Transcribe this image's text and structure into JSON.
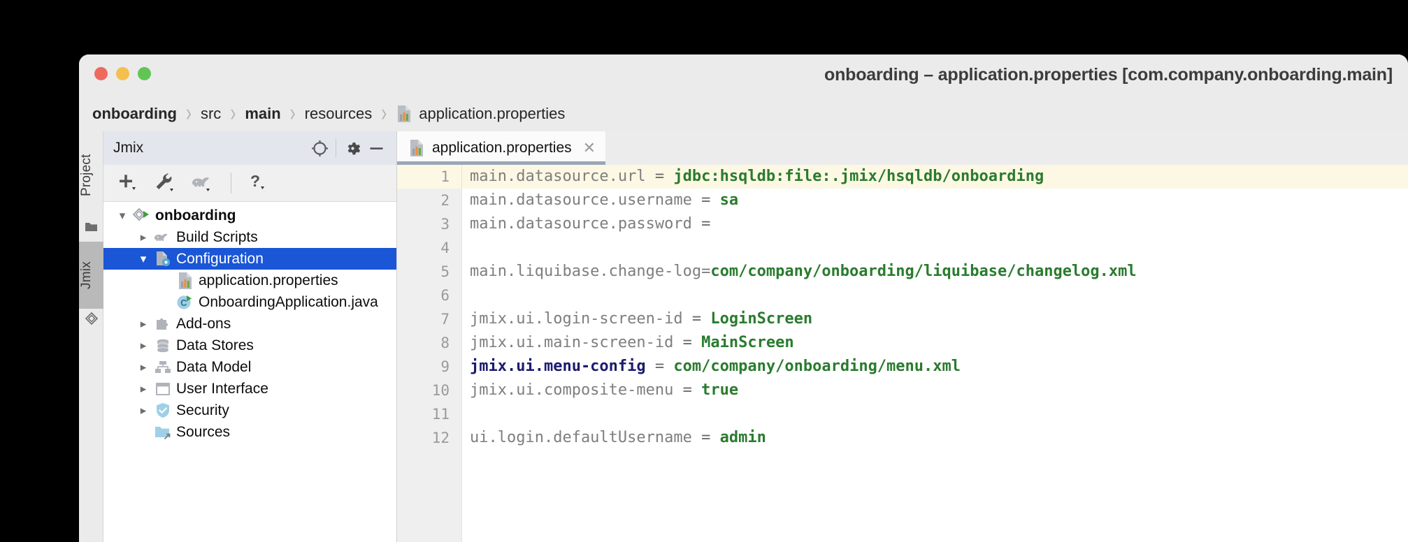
{
  "window": {
    "title": "onboarding – application.properties [com.company.onboarding.main]",
    "traffic_colors": {
      "close": "#ed6a5e",
      "minimize": "#f5bf4f",
      "zoom": "#61c554"
    }
  },
  "breadcrumb": {
    "items": [
      {
        "label": "onboarding",
        "bold": true,
        "icon": ""
      },
      {
        "label": "src",
        "bold": false,
        "icon": ""
      },
      {
        "label": "main",
        "bold": true,
        "icon": ""
      },
      {
        "label": "resources",
        "bold": false,
        "icon": ""
      },
      {
        "label": "application.properties",
        "bold": false,
        "icon": "properties-file-icon"
      }
    ],
    "separator": "›"
  },
  "stripe": {
    "labels": [
      {
        "text": "Project",
        "active": false,
        "icon": "folder-icon"
      },
      {
        "text": "Jmix",
        "active": true,
        "icon": "jmix-logo-icon"
      }
    ]
  },
  "toolwindow": {
    "title": "Jmix",
    "header_buttons": [
      {
        "name": "locate-target-icon",
        "glyph": "⌖"
      },
      {
        "name": "gear-icon",
        "glyph": "⚙"
      },
      {
        "name": "minimize-icon",
        "glyph": "—"
      }
    ],
    "toolbar_buttons": [
      {
        "name": "add-button",
        "icon": "plus-icon"
      },
      {
        "name": "settings-button",
        "icon": "wrench-icon"
      },
      {
        "name": "gradle-button",
        "icon": "elephant-icon"
      },
      {
        "name": "help-button",
        "icon": "question-mark-icon"
      }
    ],
    "tree": [
      {
        "label": "onboarding",
        "indent": 0,
        "arrow": "down",
        "icon": "jmix-project-icon",
        "bold": true,
        "selected": false
      },
      {
        "label": "Build Scripts",
        "indent": 1,
        "arrow": "right",
        "icon": "elephant-icon",
        "bold": false,
        "selected": false
      },
      {
        "label": "Configuration",
        "indent": 1,
        "arrow": "down",
        "icon": "configuration-icon",
        "bold": false,
        "selected": true
      },
      {
        "label": "application.properties",
        "indent": 2,
        "arrow": "none",
        "icon": "properties-file-icon",
        "bold": false,
        "selected": false
      },
      {
        "label": "OnboardingApplication.java",
        "indent": 2,
        "arrow": "none",
        "icon": "java-class-run-icon",
        "bold": false,
        "selected": false
      },
      {
        "label": "Add-ons",
        "indent": 1,
        "arrow": "right",
        "icon": "puzzle-icon",
        "bold": false,
        "selected": false
      },
      {
        "label": "Data Stores",
        "indent": 1,
        "arrow": "right",
        "icon": "database-icon",
        "bold": false,
        "selected": false
      },
      {
        "label": "Data Model",
        "indent": 1,
        "arrow": "right",
        "icon": "data-model-icon",
        "bold": false,
        "selected": false
      },
      {
        "label": "User Interface",
        "indent": 1,
        "arrow": "right",
        "icon": "window-icon",
        "bold": false,
        "selected": false
      },
      {
        "label": "Security",
        "indent": 1,
        "arrow": "right",
        "icon": "shield-icon",
        "bold": false,
        "selected": false
      },
      {
        "label": "Sources",
        "indent": 1,
        "arrow": "none",
        "icon": "source-folder-icon",
        "bold": false,
        "selected": false
      }
    ]
  },
  "editor": {
    "tabs": [
      {
        "label": "application.properties",
        "icon": "properties-file-icon",
        "active": true,
        "close": "✕"
      }
    ],
    "current_line": 1,
    "lines": [
      {
        "n": 1,
        "tokens": [
          {
            "t": "main.datasource.url",
            "c": "k"
          },
          {
            "t": " = ",
            "c": "eq"
          },
          {
            "t": "jdbc:hsqldb:file:.jmix/hsqldb/onboarding",
            "c": "v"
          }
        ]
      },
      {
        "n": 2,
        "tokens": [
          {
            "t": "main.datasource.username",
            "c": "k"
          },
          {
            "t": " = ",
            "c": "eq"
          },
          {
            "t": "sa",
            "c": "v"
          }
        ]
      },
      {
        "n": 3,
        "tokens": [
          {
            "t": "main.datasource.password",
            "c": "k"
          },
          {
            "t": " =",
            "c": "eq"
          }
        ]
      },
      {
        "n": 4,
        "tokens": []
      },
      {
        "n": 5,
        "tokens": [
          {
            "t": "main.liquibase.change-log=",
            "c": "k"
          },
          {
            "t": "com/company/onboarding/liquibase/changelog.xml",
            "c": "v"
          }
        ]
      },
      {
        "n": 6,
        "tokens": []
      },
      {
        "n": 7,
        "tokens": [
          {
            "t": "jmix.ui.login-screen-id",
            "c": "k"
          },
          {
            "t": " = ",
            "c": "eq"
          },
          {
            "t": "LoginScreen",
            "c": "v"
          }
        ]
      },
      {
        "n": 8,
        "tokens": [
          {
            "t": "jmix.ui.main-screen-id",
            "c": "k"
          },
          {
            "t": " = ",
            "c": "eq"
          },
          {
            "t": "MainScreen",
            "c": "v"
          }
        ]
      },
      {
        "n": 9,
        "tokens": [
          {
            "t": "jmix.ui.menu-config",
            "c": "kb"
          },
          {
            "t": " = ",
            "c": "eq"
          },
          {
            "t": "com/company/onboarding/menu.xml",
            "c": "v"
          }
        ]
      },
      {
        "n": 10,
        "tokens": [
          {
            "t": "jmix.ui.composite-menu",
            "c": "k"
          },
          {
            "t": " = ",
            "c": "eq"
          },
          {
            "t": "true",
            "c": "v"
          }
        ]
      },
      {
        "n": 11,
        "tokens": []
      },
      {
        "n": 12,
        "tokens": [
          {
            "t": "ui.login.defaultUsername",
            "c": "k"
          },
          {
            "t": " = ",
            "c": "eq"
          },
          {
            "t": "admin",
            "c": "v"
          }
        ]
      }
    ]
  },
  "colors": {
    "selection_blue": "#1a56d6",
    "value_green": "#2a7b2e",
    "key_gray": "#7e7e7e",
    "key_bold_navy": "#1b1b6e",
    "current_line_bg": "#fdf8e4",
    "toolwindow_header": "#e3e7ed"
  }
}
